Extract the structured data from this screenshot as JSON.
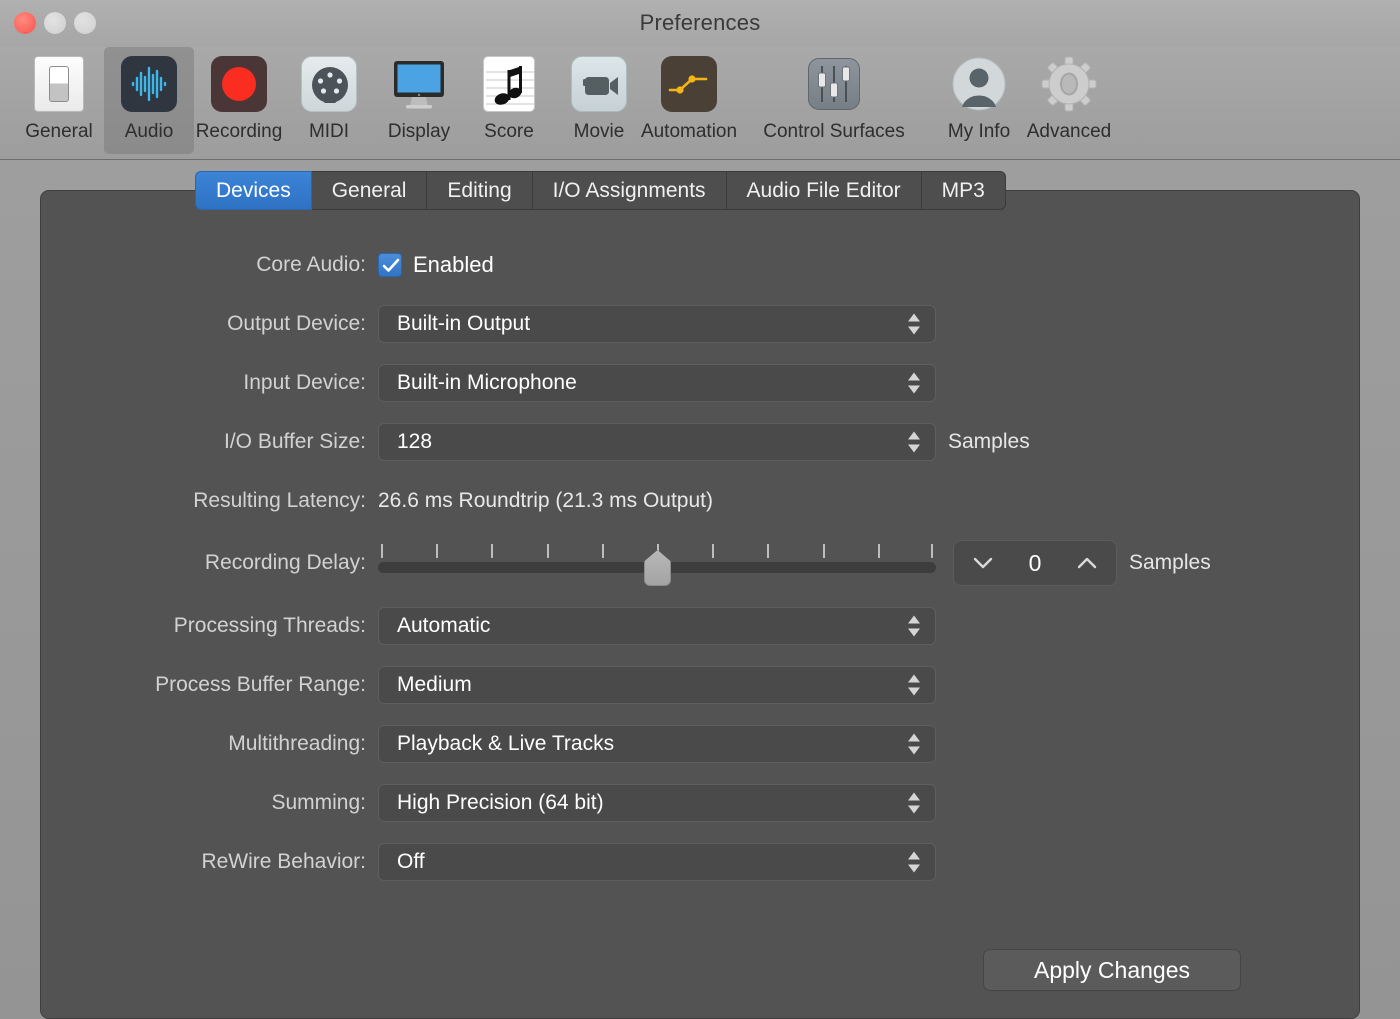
{
  "window": {
    "title": "Preferences",
    "traffic_lights": [
      "close",
      "minimize",
      "zoom"
    ]
  },
  "toolbar": {
    "items": [
      {
        "label": "General",
        "icon": "switch-icon",
        "selected": false
      },
      {
        "label": "Audio",
        "icon": "waveform-icon",
        "selected": true
      },
      {
        "label": "Recording",
        "icon": "record-dot-icon",
        "selected": false
      },
      {
        "label": "MIDI",
        "icon": "midi-port-icon",
        "selected": false
      },
      {
        "label": "Display",
        "icon": "monitor-icon",
        "selected": false
      },
      {
        "label": "Score",
        "icon": "music-note-icon",
        "selected": false
      },
      {
        "label": "Movie",
        "icon": "video-camera-icon",
        "selected": false
      },
      {
        "label": "Automation",
        "icon": "line-graph-icon",
        "selected": false
      },
      {
        "label": "Control Surfaces",
        "icon": "faders-icon",
        "selected": false
      },
      {
        "label": "My Info",
        "icon": "user-avatar-icon",
        "selected": false
      },
      {
        "label": "Advanced",
        "icon": "gear-icon",
        "selected": false
      }
    ]
  },
  "tabs": [
    {
      "label": "Devices",
      "active": true
    },
    {
      "label": "General",
      "active": false
    },
    {
      "label": "Editing",
      "active": false
    },
    {
      "label": "I/O Assignments",
      "active": false
    },
    {
      "label": "Audio File Editor",
      "active": false
    },
    {
      "label": "MP3",
      "active": false
    }
  ],
  "form": {
    "core_audio": {
      "label": "Core Audio:",
      "checkbox_label": "Enabled",
      "checked": true
    },
    "output_device": {
      "label": "Output Device:",
      "value": "Built-in Output"
    },
    "input_device": {
      "label": "Input Device:",
      "value": "Built-in Microphone"
    },
    "io_buffer_size": {
      "label": "I/O Buffer Size:",
      "value": "128",
      "unit": "Samples"
    },
    "resulting_latency": {
      "label": "Resulting Latency:",
      "value": "26.6 ms Roundtrip (21.3 ms Output)"
    },
    "recording_delay": {
      "label": "Recording Delay:",
      "slider": {
        "min": -5,
        "max": 5,
        "value": 0,
        "tick_count": 11,
        "thumb_percent": 50
      },
      "stepper_value": "0",
      "unit": "Samples"
    },
    "processing_threads": {
      "label": "Processing Threads:",
      "value": "Automatic"
    },
    "process_buffer_range": {
      "label": "Process Buffer Range:",
      "value": "Medium"
    },
    "multithreading": {
      "label": "Multithreading:",
      "value": "Playback & Live Tracks"
    },
    "summing": {
      "label": "Summing:",
      "value": "High Precision (64 bit)"
    },
    "rewire_behavior": {
      "label": "ReWire Behavior:",
      "value": "Off"
    }
  },
  "actions": {
    "apply_label": "Apply Changes"
  },
  "colors": {
    "accent_blue": "#3173c6",
    "panel_bg": "#535353",
    "field_bg": "#4a4a4a",
    "window_chrome": "#a6a6a6",
    "record_red": "#fb2c20",
    "automation_yellow": "#f5b518"
  }
}
